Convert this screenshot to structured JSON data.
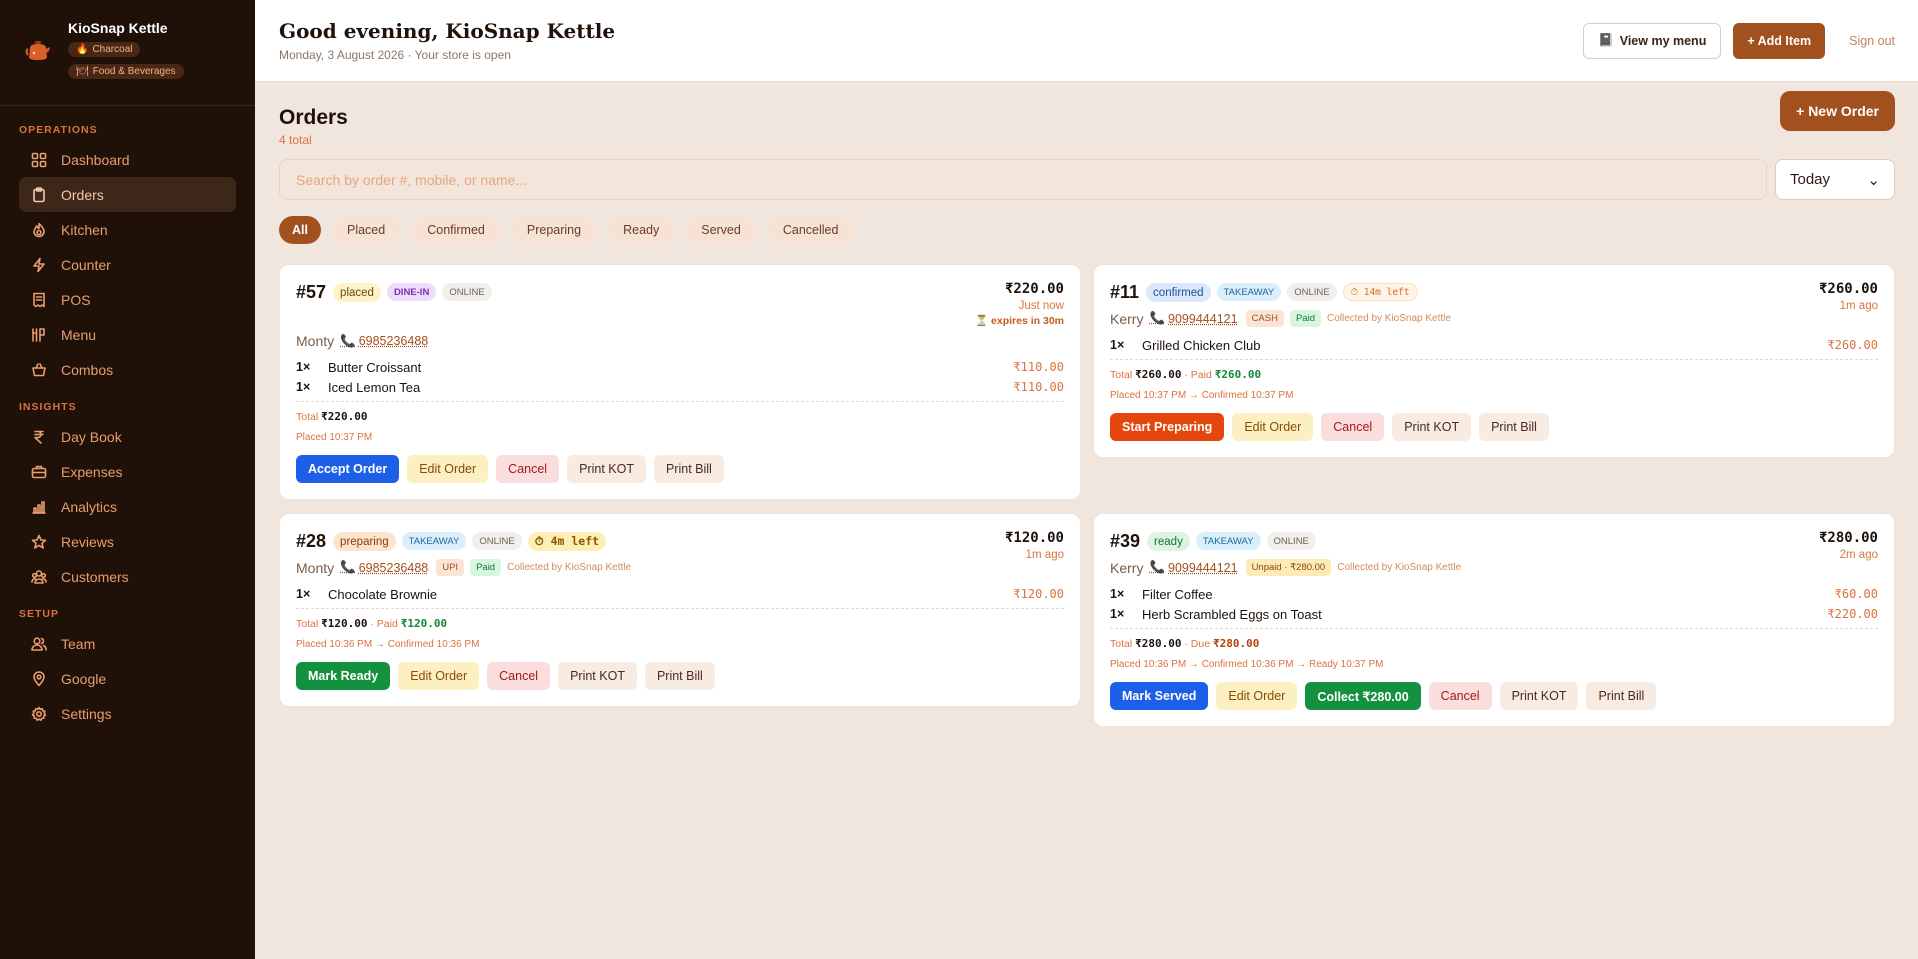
{
  "brand": {
    "name": "KioSnap Kettle",
    "badges": [
      "Charcoal",
      "Food & Beverages"
    ]
  },
  "sidebar": {
    "sections": [
      {
        "title": "OPERATIONS",
        "items": [
          {
            "label": "Dashboard",
            "icon": "dashboard-icon"
          },
          {
            "label": "Orders",
            "icon": "clipboard-icon",
            "active": true
          },
          {
            "label": "Kitchen",
            "icon": "flame-icon"
          },
          {
            "label": "Counter",
            "icon": "bolt-icon"
          },
          {
            "label": "POS",
            "icon": "receipt-icon"
          },
          {
            "label": "Menu",
            "icon": "menu-icon"
          },
          {
            "label": "Combos",
            "icon": "combos-icon"
          }
        ]
      },
      {
        "title": "INSIGHTS",
        "items": [
          {
            "label": "Day Book",
            "icon": "rupee-icon"
          },
          {
            "label": "Expenses",
            "icon": "briefcase-icon"
          },
          {
            "label": "Analytics",
            "icon": "chart-icon"
          },
          {
            "label": "Reviews",
            "icon": "star-icon"
          },
          {
            "label": "Customers",
            "icon": "users-icon"
          }
        ]
      },
      {
        "title": "SETUP",
        "items": [
          {
            "label": "Team",
            "icon": "team-icon"
          },
          {
            "label": "Google",
            "icon": "pin-icon"
          },
          {
            "label": "Settings",
            "icon": "gear-icon"
          }
        ]
      }
    ]
  },
  "header": {
    "greeting": "Good evening, KioSnap Kettle",
    "subtitle": "Monday, 3 August 2026 · Your store is open",
    "view_menu": "View my menu",
    "add_item": "+ Add Item",
    "sign_out": "Sign out"
  },
  "orders": {
    "title": "Orders",
    "count": "4 total",
    "new_order": "+ New Order",
    "search_placeholder": "Search by order #, mobile, or name...",
    "range": "Today",
    "filters": [
      "All",
      "Placed",
      "Confirmed",
      "Preparing",
      "Ready",
      "Served",
      "Cancelled"
    ],
    "active_filter": "All"
  },
  "cards": {
    "o57": {
      "number": "#57",
      "status": "placed",
      "type": "DINE-IN",
      "channel": "ONLINE",
      "amount": "₹220.00",
      "ago": "Just now",
      "expires": "⏳ expires in 30m",
      "customer": "Monty",
      "phone": "6985236488",
      "items": [
        {
          "qty": "1×",
          "name": "Butter Croissant",
          "price": "₹110.00"
        },
        {
          "qty": "1×",
          "name": "Iced Lemon Tea",
          "price": "₹110.00"
        }
      ],
      "total_label": "Total",
      "total": "₹220.00",
      "timeline": "Placed 10:37 PM",
      "actions": [
        "Accept Order",
        "Edit Order",
        "Cancel",
        "Print KOT",
        "Print Bill"
      ]
    },
    "o11": {
      "number": "#11",
      "status": "confirmed",
      "type": "TAKEAWAY",
      "channel": "ONLINE",
      "timer": "⏱ 14m left",
      "amount": "₹260.00",
      "ago": "1m ago",
      "customer": "Kerry",
      "phone": "9099444121",
      "method": "CASH",
      "paid": "Paid",
      "collected": "Collected by KioSnap Kettle",
      "items": [
        {
          "qty": "1×",
          "name": "Grilled Chicken Club",
          "price": "₹260.00"
        }
      ],
      "total_label": "Total",
      "total": "₹260.00",
      "paid_label": "· Paid",
      "paid_amount": "₹260.00",
      "timeline": "Placed 10:37 PM → Confirmed 10:37 PM",
      "actions": [
        "Start Preparing",
        "Edit Order",
        "Cancel",
        "Print KOT",
        "Print Bill"
      ]
    },
    "o28": {
      "number": "#28",
      "status": "preparing",
      "type": "TAKEAWAY",
      "channel": "ONLINE",
      "timer": "⏱ 4m left",
      "amount": "₹120.00",
      "ago": "1m ago",
      "customer": "Monty",
      "phone": "6985236488",
      "method": "UPI",
      "paid": "Paid",
      "collected": "Collected by KioSnap Kettle",
      "items": [
        {
          "qty": "1×",
          "name": "Chocolate Brownie",
          "price": "₹120.00"
        }
      ],
      "total_label": "Total",
      "total": "₹120.00",
      "paid_label": "· Paid",
      "paid_amount": "₹120.00",
      "timeline": "Placed 10:36 PM → Confirmed 10:36 PM",
      "actions": [
        "Mark Ready",
        "Edit Order",
        "Cancel",
        "Print KOT",
        "Print Bill"
      ]
    },
    "o39": {
      "number": "#39",
      "status": "ready",
      "type": "TAKEAWAY",
      "channel": "ONLINE",
      "amount": "₹280.00",
      "ago": "2m ago",
      "customer": "Kerry",
      "phone": "9099444121",
      "unpaid": "Unpaid · ₹280.00",
      "collected": "Collected by KioSnap Kettle",
      "items": [
        {
          "qty": "1×",
          "name": "Filter Coffee",
          "price": "₹60.00"
        },
        {
          "qty": "1×",
          "name": "Herb Scrambled Eggs on Toast",
          "price": "₹220.00"
        }
      ],
      "total_label": "Total",
      "total": "₹280.00",
      "due_label": "· Due",
      "due_amount": "₹280.00",
      "timeline": "Placed 10:36 PM → Confirmed 10:36 PM → Ready 10:37 PM",
      "actions": [
        "Mark Served",
        "Edit Order",
        "Collect ₹280.00",
        "Cancel",
        "Print KOT",
        "Print Bill"
      ]
    }
  },
  "colors": {
    "sidebar_bg": "#1f1008",
    "accent": "#a3501f",
    "page_bg": "#f1e6dd",
    "blue": "#1e5fe8",
    "orange": "#e4470e",
    "green": "#14913f"
  }
}
